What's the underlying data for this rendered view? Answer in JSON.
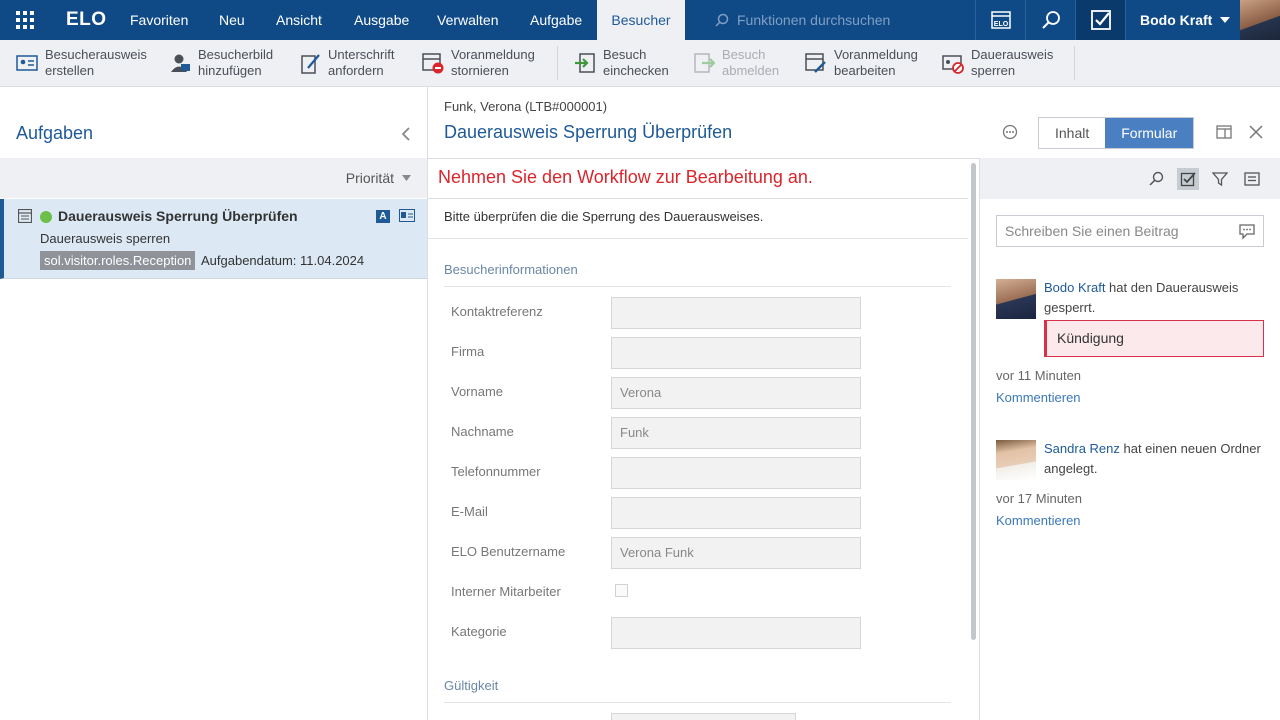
{
  "app": {
    "logo": "ELO"
  },
  "nav": {
    "items": [
      "Favoriten",
      "Neu",
      "Ansicht",
      "Ausgabe",
      "Verwalten",
      "Aufgabe",
      "Besucher"
    ],
    "search_placeholder": "Funktionen durchsuchen",
    "user": "Bodo Kraft"
  },
  "ribbon": [
    {
      "line1": "Besucherausweis",
      "line2": "erstellen",
      "icon": "badge-icon"
    },
    {
      "line1": "Besucherbild",
      "line2": "hinzufügen",
      "icon": "person-photo-icon"
    },
    {
      "line1": "Unterschrift",
      "line2": "anfordern",
      "icon": "signature-icon"
    },
    {
      "line1": "Voranmeldung",
      "line2": "stornieren",
      "icon": "cancel-registration-icon"
    },
    {
      "line1": "Besuch",
      "line2": "einchecken",
      "icon": "checkin-icon"
    },
    {
      "line1": "Besuch",
      "line2": "abmelden",
      "icon": "checkout-icon"
    },
    {
      "line1": "Voranmeldung",
      "line2": "bearbeiten",
      "icon": "edit-registration-icon"
    },
    {
      "line1": "Dauerausweis",
      "line2": "sperren",
      "icon": "block-badge-icon"
    }
  ],
  "tasks_panel": {
    "title": "Aufgaben",
    "sort_label": "Priorität",
    "task": {
      "title": "Dauerausweis Sperrung Überprüfen",
      "subtitle": "Dauerausweis sperren",
      "role": "sol.visitor.roles.Reception",
      "date": "Aufgabendatum: 11.04.2024",
      "badge": "A"
    }
  },
  "document": {
    "breadcrumb": "Funk, Verona (LTB#000001)",
    "title": "Dauerausweis Sperrung Überprüfen",
    "tabs": [
      "Inhalt",
      "Formular"
    ],
    "active_tab": "Formular"
  },
  "form": {
    "warning": "Nehmen Sie den Workflow zur Bearbeitung an.",
    "description": "Bitte überprüfen die die Sperrung des Dauerausweises.",
    "section1": "Besucherinformationen",
    "fields": [
      {
        "label": "Kontaktreferenz",
        "value": ""
      },
      {
        "label": "Firma",
        "value": ""
      },
      {
        "label": "Vorname",
        "value": "Verona"
      },
      {
        "label": "Nachname",
        "value": "Funk"
      },
      {
        "label": "Telefonnummer",
        "value": ""
      },
      {
        "label": "E-Mail",
        "value": ""
      },
      {
        "label": "ELO Benutzername",
        "value": "Verona Funk"
      },
      {
        "label": "Interner Mitarbeiter",
        "value": ""
      },
      {
        "label": "Kategorie",
        "value": ""
      }
    ],
    "section2": "Gültigkeit"
  },
  "feed": {
    "post_placeholder": "Schreiben Sie einen Beitrag",
    "entries": [
      {
        "author": "Bodo Kraft",
        "text": " hat den Dauerausweis gesperrt.",
        "quote": "Kündigung",
        "time": "vor 11 Minuten",
        "link": "Kommentieren"
      },
      {
        "author": "Sandra Renz",
        "text": " hat einen neuen Ordner angelegt.",
        "time": "vor 17 Minuten",
        "link": "Kommentieren"
      }
    ]
  },
  "colors": {
    "brand": "#0f4a87",
    "accent": "#1f5a97",
    "warning": "#d9262c",
    "status_green": "#6cc04a"
  }
}
